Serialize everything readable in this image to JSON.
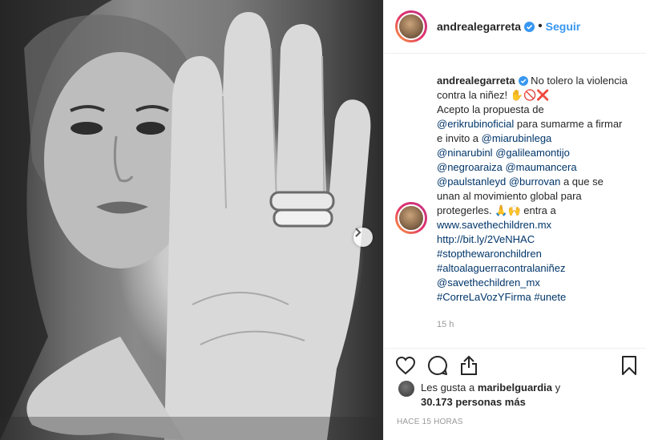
{
  "post": {
    "username": "andrealegarreta",
    "follow_label": "Seguir",
    "dot": "•",
    "next_icon": "chevron-right-icon"
  },
  "caption": {
    "username": "andrealegarreta",
    "line1": " No tolero la violencia contra la niñez! ✋🚫❌",
    "line2": "Acepto la propuesta de",
    "m1": "@erikrubinoficial",
    "line3": " para sumarme a firmar e invito a ",
    "m2": "@miarubinlega",
    "m3": "@ninarubinl",
    "m4": "@galileamontijo",
    "m5": "@negroaraiza",
    "m6": "@maumancera",
    "m7": "@paulstanleyd",
    "m8": "@burrovan",
    "line4": " a que se unan al movimiento global para protegerles. 🙏🙌 entra a",
    "url1": "www.savethechildren.mx",
    "url2": "http://bit.ly/2VeNHAC",
    "h1": "#stopthewaronchildren",
    "h2": "#altoalaguerracontralaniñez",
    "m9": "@savethechildren_mx",
    "h3": "#CorreLaVozYFirma",
    "h4": "#unete",
    "time": "15 h"
  },
  "likes": {
    "prefix": "Les gusta a ",
    "user": "maribelguardia",
    "mid": " y",
    "count": "30.173 personas más"
  },
  "posted_ago": "HACE 15 HORAS",
  "icons": {
    "like": "heart-icon",
    "comment": "comment-icon",
    "share": "share-icon",
    "save": "bookmark-icon"
  }
}
